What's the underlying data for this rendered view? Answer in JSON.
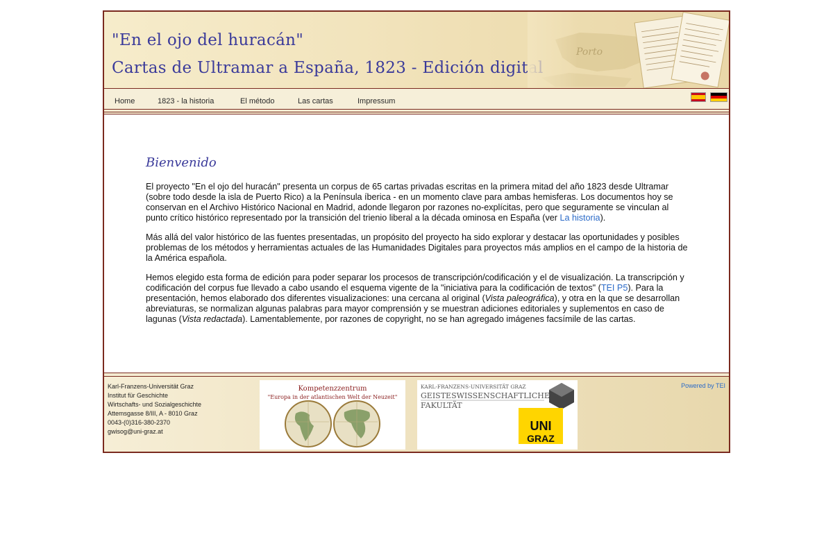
{
  "header": {
    "title_line1": "\"En el ojo del huracán\"",
    "title_line2": "Cartas de Ultramar a España, 1823 - Edición digital"
  },
  "nav": {
    "items": [
      "Home",
      "1823 - la historia",
      "El método",
      "Las cartas",
      "Impressum"
    ],
    "flags": [
      "es-flag-icon",
      "de-flag-icon"
    ]
  },
  "main": {
    "heading": "Bienvenido",
    "p1_before": "El proyecto \"En el ojo del huracán\" presenta un corpus de 65 cartas privadas escritas en la primera mitad del año 1823 desde Ultramar (sobre todo desde la isla de Puerto Rico) a la Península íberica - en un momento clave para ambas hemisferas. Los documentos hoy se conservan en el Archivo Histórico Nacional en Madrid, adonde llegaron por razones no-explícitas, pero que seguramente se vinculan al punto crítico histórico representado por la transición del trienio liberal a la década ominosa en España (ver ",
    "p1_link": "La historia",
    "p1_after": ").",
    "p2": "Más allá del valor histórico de las fuentes presentadas, un propósito del proyecto ha sido explorar y destacar las oportunidades y posibles problemas de los métodos y herramientas actuales de las Humanidades Digitales para proyectos más amplios en el campo de la historia de la América española.",
    "p3_a": "Hemos elegido esta forma de edición para poder separar los procesos de transcripción/codificación y el de visualización. La transcripción y codificación del corpus fue llevado a cabo usando el esquema vigente de la \"iniciativa para la codificación de textos\" (",
    "p3_link": "TEI P5",
    "p3_b": "). Para la presentación, hemos elaborado dos diferentes visualizaciones: una cercana al original (",
    "p3_em1": "Vista paleográfica",
    "p3_c": "), y otra en la que se desarrollan abreviaturas, se normalizan algunas palabras para mayor comprensión y se muestran adiciones editoriales y suplementos en caso de lagunas (",
    "p3_em2": "Vista redactada",
    "p3_d": "). Lamentablemente, por razones de copyright, no se han agregado imágenes facsímile de las cartas."
  },
  "footer": {
    "address": [
      "Karl-Franzens-Universität Graz",
      "Institut für Geschichte",
      "Wirtschafts- und Sozialgeschichte",
      "Attemsgasse 8/III, A - 8010 Graz",
      "0043-(0)316-380-2370",
      "gwisog@uni-graz.at"
    ],
    "kompetenz_title": "Kompetenzzentrum",
    "kompetenz_sub": "\"Europa in der atlantischen Welt der Neuzeit\"",
    "uni_line1": "KARL-FRANZENS-UNIVERSITÄT GRAZ",
    "uni_line2": "GEISTESWISSENSCHAFTLICHE",
    "uni_line3": "FAKULTÄT",
    "uni_logo_a": "UNI",
    "uni_logo_b": "GRAZ",
    "powered_prefix": "Powered by ",
    "powered_link": "TEI"
  },
  "colors": {
    "title_blue": "#3a3a9a",
    "link_blue": "#2a6ac8",
    "border_brown": "#7a2a1f",
    "uni_yellow": "#ffd500"
  }
}
